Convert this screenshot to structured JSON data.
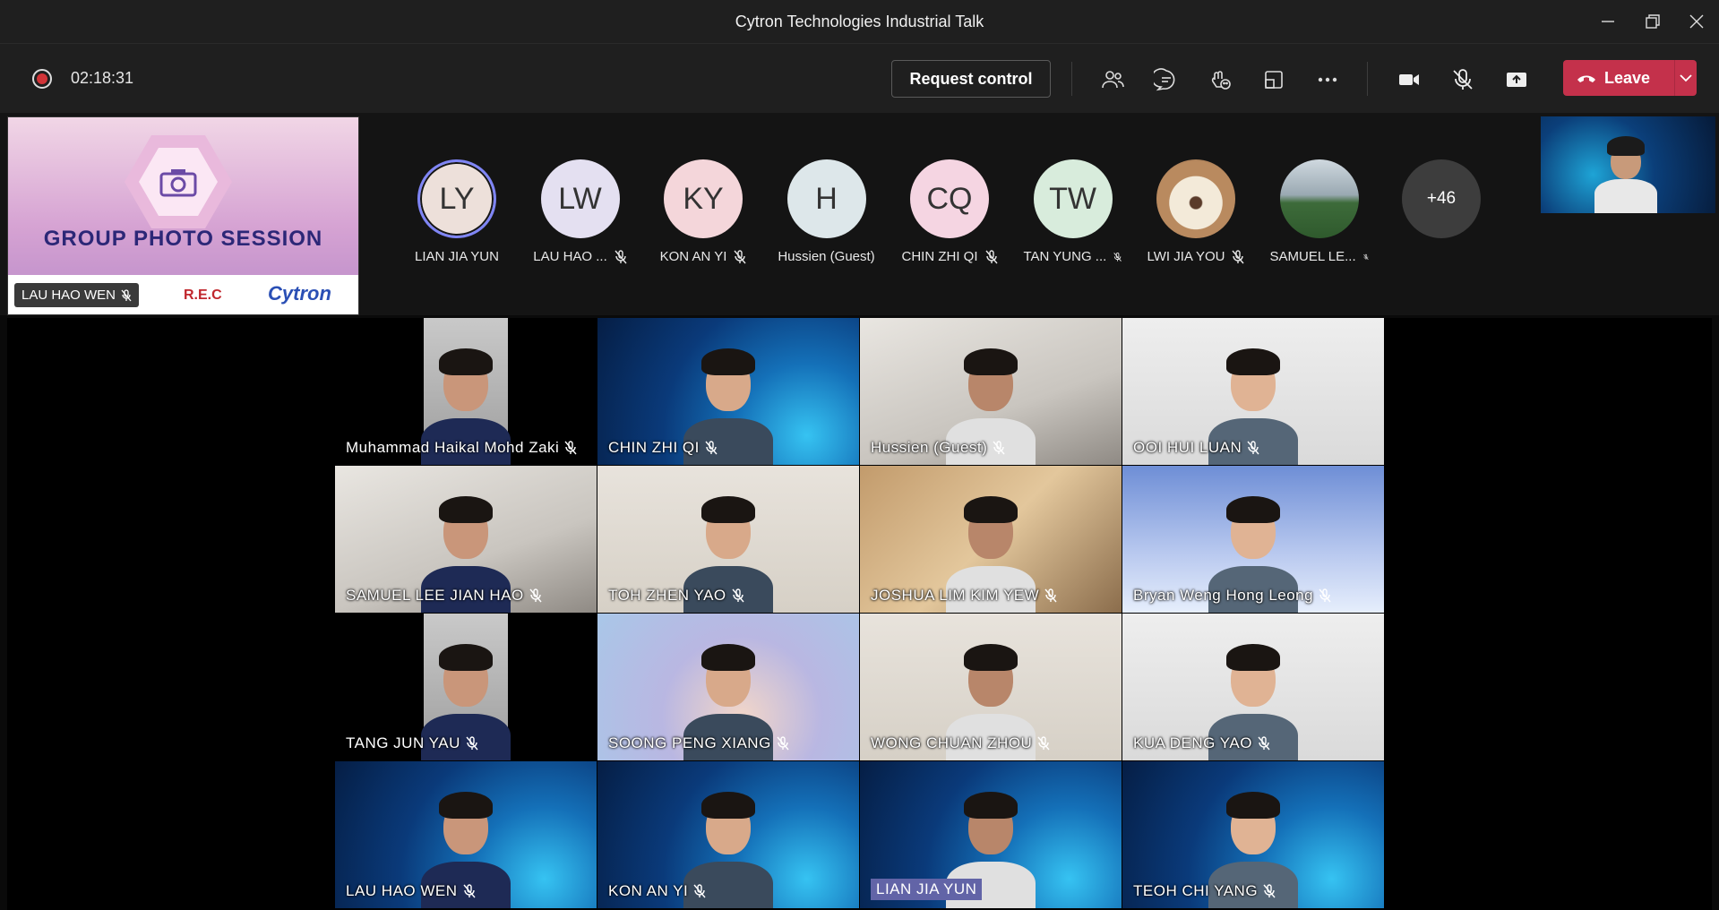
{
  "window": {
    "title": "Cytron Technologies Industrial Talk"
  },
  "toolbar": {
    "timer": "02:18:31",
    "request_control_label": "Request control",
    "leave_label": "Leave",
    "icons": [
      "participants-icon",
      "chat-icon",
      "reactions-icon",
      "rooms-icon",
      "more-options-icon",
      "camera-icon",
      "mic-off-icon",
      "share-icon"
    ]
  },
  "shared_content": {
    "title": "GROUP PHOTO SESSION",
    "presenter": "LAU HAO WEN",
    "logo_left": "R.E.C",
    "logo_right": "Cytron"
  },
  "participants": [
    {
      "initials": "LY",
      "name": "LIAN JIA YUN",
      "muted": false,
      "active": true,
      "bg": "#ede0da"
    },
    {
      "initials": "LW",
      "name": "LAU HAO ...",
      "muted": true,
      "bg": "#e4e0f1"
    },
    {
      "initials": "KY",
      "name": "KON AN YI",
      "muted": true,
      "bg": "#f4d6da"
    },
    {
      "initials": "H",
      "name": "Hussien (Guest)",
      "muted": false,
      "bg": "#dde7ea"
    },
    {
      "initials": "CQ",
      "name": "CHIN ZHI QI",
      "muted": true,
      "bg": "#f5d5e2"
    },
    {
      "initials": "TW",
      "name": "TAN YUNG ...",
      "muted": true,
      "bg": "#d8ecdc"
    },
    {
      "initials": "",
      "name": "LWI JIA YOU",
      "muted": true,
      "photo": "cat"
    },
    {
      "initials": "",
      "name": "SAMUEL LE...",
      "muted": true,
      "photo": "field"
    }
  ],
  "more_count": "+46",
  "tiles": [
    {
      "name": "Muhammad Haikal Mohd Zaki",
      "bg": "dark"
    },
    {
      "name": "CHIN ZHI QI",
      "bg": "cyber"
    },
    {
      "name": "Hussien (Guest)",
      "bg": "room"
    },
    {
      "name": "OOI HUI LUAN",
      "bg": "white"
    },
    {
      "name": "SAMUEL LEE JIAN HAO",
      "bg": "room"
    },
    {
      "name": "TOH ZHEN YAO",
      "bg": "cafe"
    },
    {
      "name": "JOSHUA LIM KIM YEW",
      "bg": "office"
    },
    {
      "name": "Bryan Weng Hong Leong",
      "bg": "ice"
    },
    {
      "name": "TANG JUN YAU",
      "bg": "dark"
    },
    {
      "name": "SOONG PENG XIANG",
      "bg": "art"
    },
    {
      "name": "WONG CHUAN ZHOU",
      "bg": "cafe"
    },
    {
      "name": "KUA DENG YAO",
      "bg": "white"
    },
    {
      "name": "LAU HAO WEN",
      "bg": "cyber"
    },
    {
      "name": "KON AN YI",
      "bg": "cyber"
    },
    {
      "name": "LIAN JIA YUN",
      "bg": "cyber",
      "speaking": true
    },
    {
      "name": "TEOH CHI YANG",
      "bg": "cyber"
    }
  ],
  "colors": {
    "leave": "#c4314b",
    "active_ring": "#7f85f5",
    "speaking_chip": "#6264a7"
  }
}
